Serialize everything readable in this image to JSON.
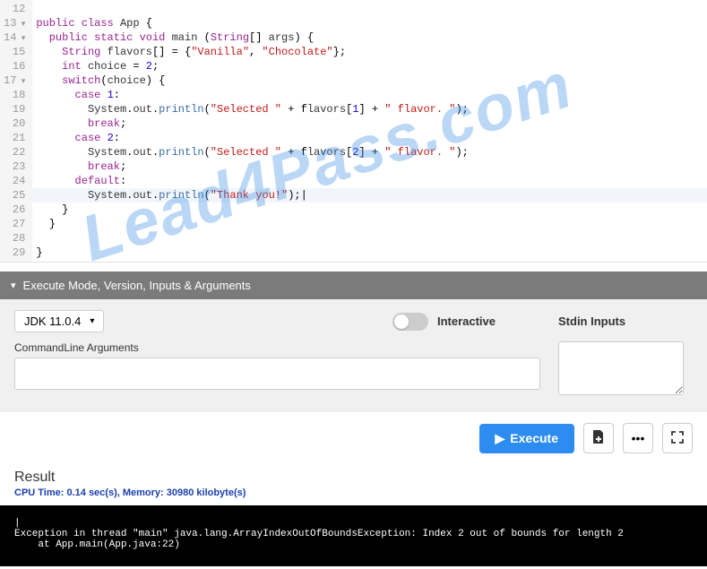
{
  "editor": {
    "lines": [
      {
        "n": "12",
        "fold": false,
        "html": ""
      },
      {
        "n": "13",
        "fold": true,
        "html": "<span class='kw'>public</span> <span class='kw'>class</span> <span class='ident'>App</span> {"
      },
      {
        "n": "14",
        "fold": true,
        "html": "  <span class='kw'>public</span> <span class='kw'>static</span> <span class='type'>void</span> <span class='ident'>main</span> (<span class='type'>String</span>[] <span class='ident'>args</span>) {"
      },
      {
        "n": "15",
        "fold": false,
        "html": "    <span class='type'>String</span> <span class='ident'>flavors</span>[] = {<span class='str'>\"Vanilla\"</span>, <span class='str'>\"Chocolate\"</span>};"
      },
      {
        "n": "16",
        "fold": false,
        "html": "    <span class='type'>int</span> <span class='ident'>choice</span> = <span class='num'>2</span>;"
      },
      {
        "n": "17",
        "fold": true,
        "html": "    <span class='kw'>switch</span>(<span class='ident'>choice</span>) {"
      },
      {
        "n": "18",
        "fold": false,
        "html": "      <span class='kw'>case</span> <span class='num'>1</span>:"
      },
      {
        "n": "19",
        "fold": false,
        "html": "        <span class='ident'>System</span>.<span class='ident'>out</span>.<span class='fn'>println</span>(<span class='str'>\"Selected \"</span> + f<span class='ident'>lavors</span>[<span class='num'>1</span>] + <span class='str'>\" flavor. \"</span>);"
      },
      {
        "n": "20",
        "fold": false,
        "html": "        <span class='kw'>break</span>;"
      },
      {
        "n": "21",
        "fold": false,
        "html": "      <span class='kw'>case</span> <span class='num'>2</span>:"
      },
      {
        "n": "22",
        "fold": false,
        "html": "        <span class='ident'>System</span>.<span class='ident'>out</span>.<span class='fn'>println</span>(<span class='str'>\"Selected \"</span> + f<span class='ident'>lavors</span>[<span class='num'>2</span>] + <span class='str'>\" flavor. \"</span>);"
      },
      {
        "n": "23",
        "fold": false,
        "html": "        <span class='kw'>break</span>;"
      },
      {
        "n": "24",
        "fold": false,
        "html": "      <span class='kw'>default</span>:"
      },
      {
        "n": "25",
        "fold": false,
        "hl": true,
        "html": "        <span class='ident'>System</span>.<span class='ident'>out</span>.<span class='fn'>println</span>(<span class='str'>\"Thank you!\"</span>);|"
      },
      {
        "n": "26",
        "fold": false,
        "html": "    }"
      },
      {
        "n": "27",
        "fold": false,
        "html": "  }"
      },
      {
        "n": "28",
        "fold": false,
        "html": ""
      },
      {
        "n": "29",
        "fold": false,
        "html": "}"
      }
    ]
  },
  "panel": {
    "header": "Execute Mode, Version, Inputs & Arguments",
    "version_selected": "JDK 11.0.4",
    "interactive_label": "Interactive",
    "stdin_label": "Stdin Inputs",
    "cmdline_label": "CommandLine Arguments",
    "cmdline_value": "",
    "stdin_value": ""
  },
  "buttons": {
    "execute": "Execute"
  },
  "result": {
    "header": "Result",
    "meta": "CPU Time: 0.14 sec(s), Memory: 30980 kilobyte(s)",
    "console": "|\nException in thread \"main\" java.lang.ArrayIndexOutOfBoundsException: Index 2 out of bounds for length 2\n    at App.main(App.java:22)"
  },
  "watermark": "Lead4Pass.com"
}
